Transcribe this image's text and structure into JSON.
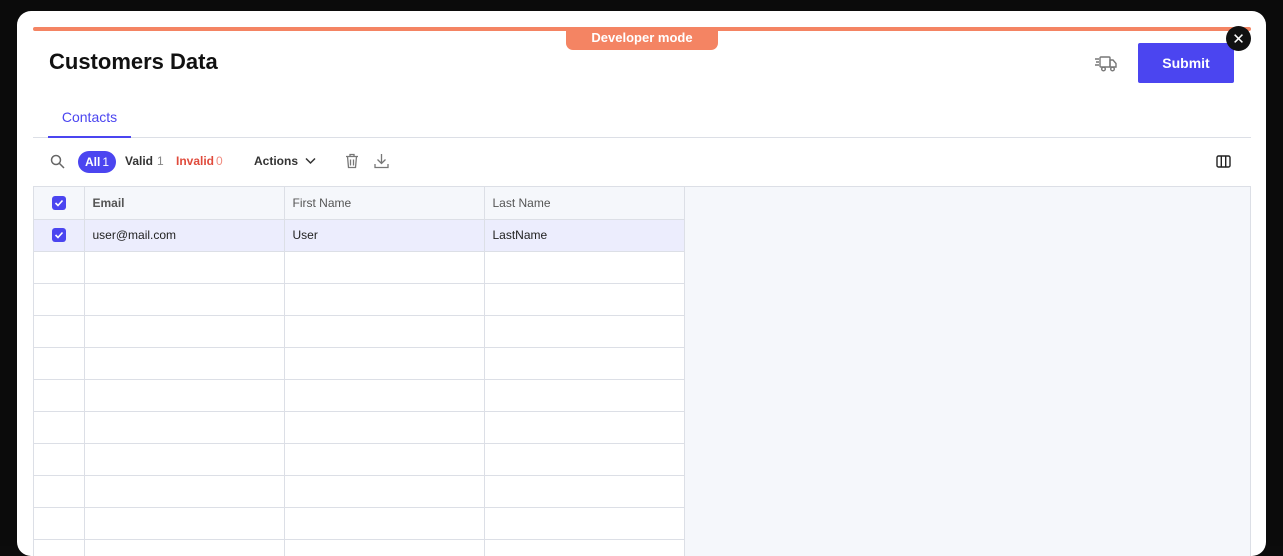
{
  "modal": {
    "badge": "Developer mode",
    "title": "Customers Data",
    "submit_label": "Submit",
    "close_glyph": "✕",
    "accent_color": "#f48463",
    "primary_color": "#4b45f0"
  },
  "tabs": [
    {
      "label": "Contacts",
      "active": true
    }
  ],
  "toolbar": {
    "search_icon": "search-icon",
    "filters": {
      "all": {
        "label": "All",
        "count": "1"
      },
      "valid": {
        "label": "Valid",
        "count": "1"
      },
      "invalid": {
        "label": "Invalid",
        "count": "0"
      }
    },
    "actions_label": "Actions",
    "icons": [
      "trash-icon",
      "download-icon",
      "columns-icon"
    ]
  },
  "grid": {
    "columns": [
      "Email",
      "First Name",
      "Last Name"
    ],
    "rows": [
      {
        "selected": true,
        "cells": [
          "user@mail.com",
          "User",
          "LastName"
        ]
      }
    ],
    "header_checked": true
  }
}
